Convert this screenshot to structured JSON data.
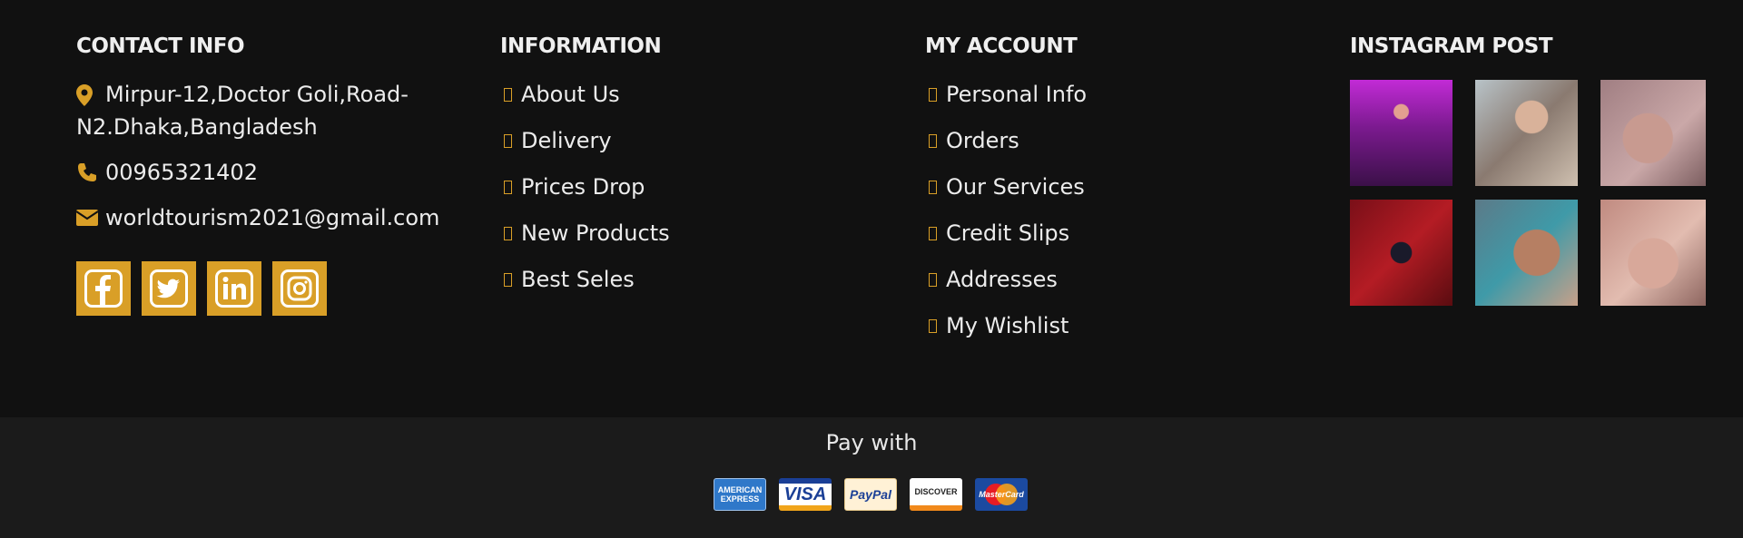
{
  "contact": {
    "title": "CONTACT INFO",
    "address": "Mirpur-12,Doctor Goli,Road-N2.Dhaka,Bangladesh",
    "phone": "00965321402",
    "email": "worldtourism2021@gmail.com",
    "social": [
      {
        "icon": "facebook-icon"
      },
      {
        "icon": "twitter-icon"
      },
      {
        "icon": "linkedin-icon"
      },
      {
        "icon": "instagram-icon"
      }
    ]
  },
  "information": {
    "title": "INFORMATION",
    "links": [
      "About Us",
      "Delivery",
      "Prices Drop",
      "New Products",
      "Best Seles"
    ]
  },
  "account": {
    "title": "MY ACCOUNT",
    "links": [
      "Personal Info",
      "Orders",
      "Our Services",
      "Credit Slips",
      "Addresses",
      "My Wishlist"
    ]
  },
  "instagram": {
    "title": "INSTAGRAM POST"
  },
  "payment": {
    "title": "Pay with",
    "cards": {
      "amex_line1": "AMERICAN",
      "amex_line2": "EXPRESS",
      "visa": "VISA",
      "paypal": "PayPal",
      "discover": "DISCOVER",
      "mastercard": "MasterCard"
    }
  },
  "colors": {
    "accent": "#d99f27",
    "background": "#111111",
    "bottom_bar": "#1b1b1b",
    "text": "#ececec"
  }
}
